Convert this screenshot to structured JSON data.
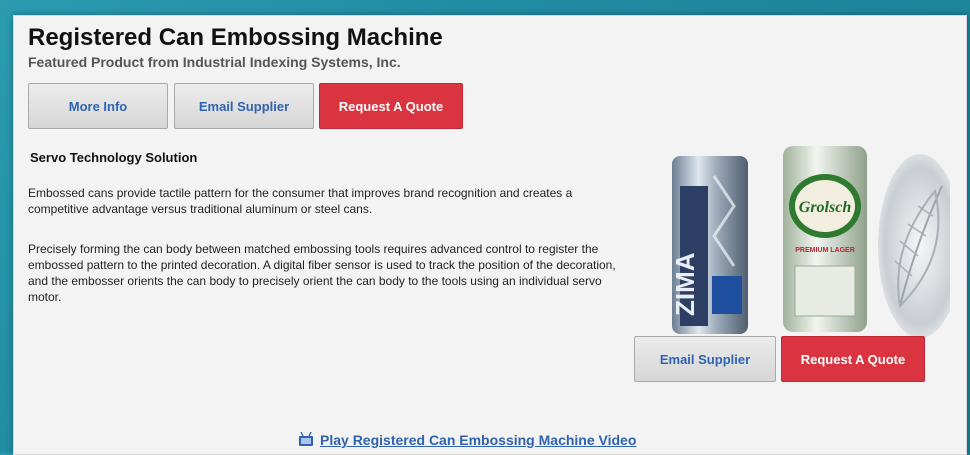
{
  "product": {
    "title": "Registered Can Embossing Machine",
    "subtitle": "Featured Product from Industrial Indexing Systems, Inc."
  },
  "buttons_top": {
    "more_info": "More Info",
    "email_supplier": "Email Supplier",
    "request_quote": "Request A Quote"
  },
  "content": {
    "heading": "Servo Technology Solution",
    "paragraph1": "Embossed cans provide tactile pattern for the consumer that improves brand recognition and creates a competitive advantage versus traditional aluminum or steel cans.",
    "paragraph2": "Precisely forming the can body between matched embossing tools requires advanced control to register the embossed pattern to the printed decoration.  A digital fiber sensor is used to track the position of the decoration, and the embosser orients the can body to precisely orient the can body to the tools using an individual servo motor."
  },
  "buttons_side": {
    "email_supplier": "Email Supplier",
    "request_quote": "Request A Quote"
  },
  "can_labels": {
    "zima": "ZIMA",
    "grolsch": "Grolsch",
    "grolsch_sub": "PREMIUM LAGER"
  },
  "video": {
    "link_text": "Play Registered Can Embossing Machine Video",
    "icon": "tv-icon"
  },
  "colors": {
    "accent_red": "#d9343f",
    "link_blue": "#2f62b0",
    "background_teal": "#2a9bb0"
  }
}
